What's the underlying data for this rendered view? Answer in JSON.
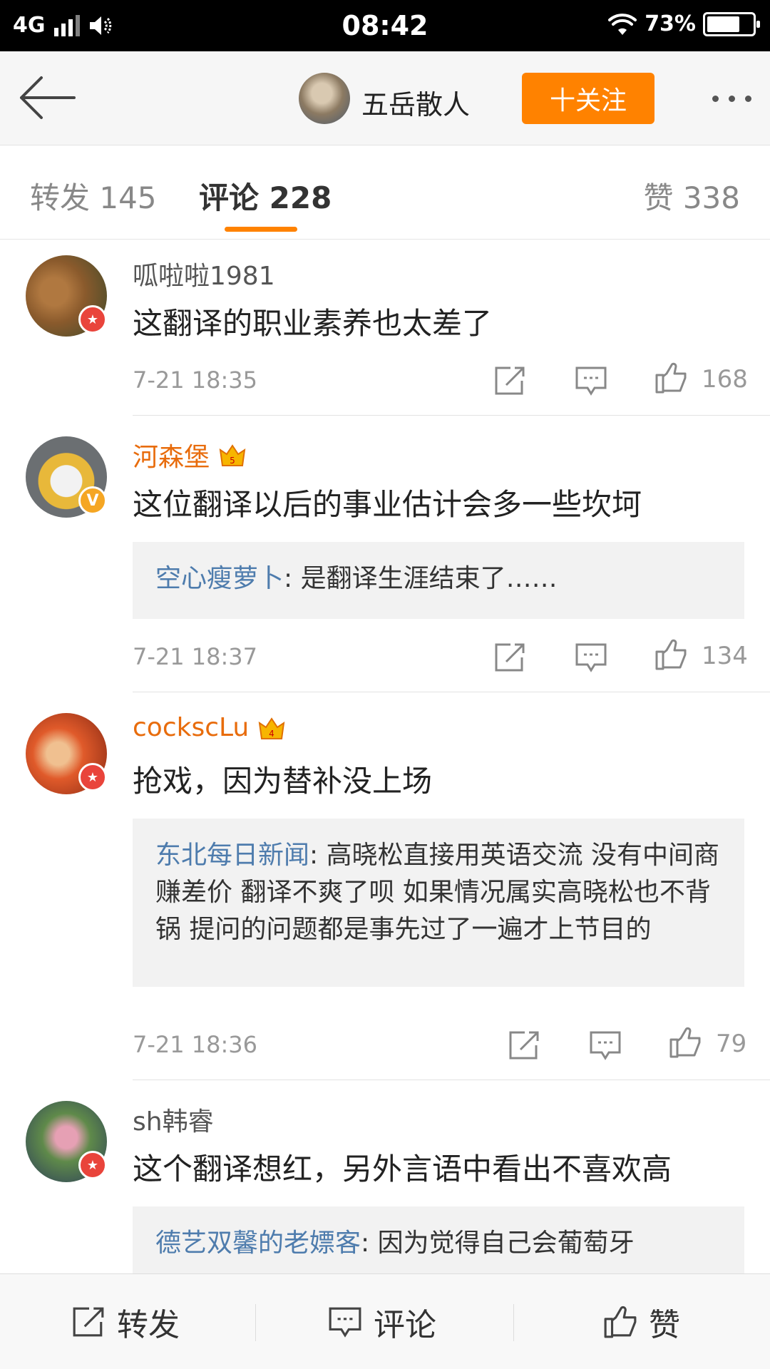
{
  "status_bar": {
    "network": "4G",
    "time": "08:42",
    "battery": "73%",
    "battery_level": 0.73
  },
  "header": {
    "profile_name": "五岳散人",
    "follow_label": "十关注"
  },
  "tabs": {
    "repost": "转发 145",
    "comments": "评论 228",
    "likes": "赞 338"
  },
  "comments": [
    {
      "username": "呱啦啦1981",
      "text": "这翻译的职业素养也太差了",
      "time": "7-21 18:35",
      "likes": "168"
    },
    {
      "username": "河森堡",
      "text": "这位翻译以后的事业估计会多一些坎坷",
      "reply_name": "空心瘦萝卜",
      "reply_text": ": 是翻译生涯结束了……",
      "time": "7-21 18:37",
      "likes": "134"
    },
    {
      "username": "cockscLu",
      "text": "抢戏，因为替补没上场",
      "reply_name": "东北每日新闻",
      "reply_text": ": 高晓松直接用英语交流 没有中间商赚差价 翻译不爽了呗 如果情况属实高晓松也不背锅 提问的问题都是事先过了一遍才上节目的",
      "time": "7-21 18:36",
      "likes": "79"
    },
    {
      "username": "sh韩睿",
      "text": "这个翻译想红，另外言语中看出不喜欢高",
      "reply_name": "德艺双馨的老嫖客",
      "reply_text": ": 因为觉得自己会葡萄牙"
    }
  ],
  "bottom_bar": {
    "repost": "转发",
    "comment": "评论",
    "like": "赞"
  },
  "colors": {
    "accent": "#ff8200",
    "vip_name": "#e86c0c",
    "reply_name": "#4e7cad"
  }
}
